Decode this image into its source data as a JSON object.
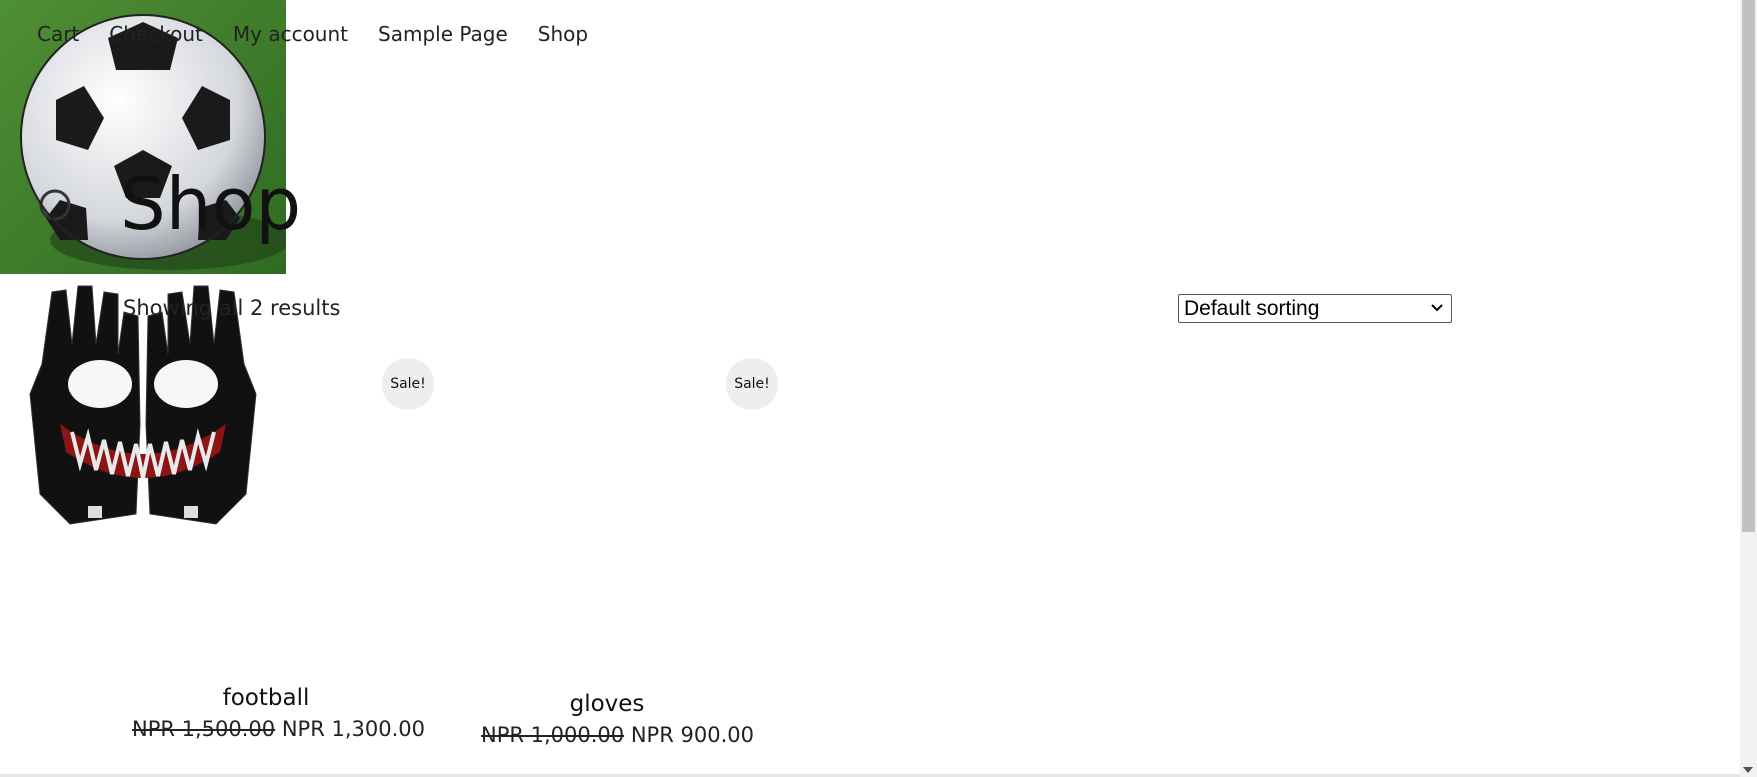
{
  "nav": {
    "items": [
      {
        "label": "Cart"
      },
      {
        "label": "Checkout"
      },
      {
        "label": "My account"
      },
      {
        "label": "Sample Page"
      },
      {
        "label": "Shop"
      }
    ]
  },
  "main": {
    "title": "Shop",
    "result_count": "Showing all 2 results",
    "sorting": {
      "selected": "Default sorting"
    },
    "products": [
      {
        "name": "football",
        "badge": "Sale!",
        "regular_price": "NPR 1,500.00",
        "sale_price": "NPR 1,300.00"
      },
      {
        "name": "gloves",
        "badge": "Sale!",
        "regular_price": "NPR 1,000.00",
        "sale_price": "NPR 900.00"
      }
    ]
  },
  "colors": {
    "text": "#111111",
    "badge_bg": "#eeeeee",
    "grass": "#3f7d2a"
  }
}
